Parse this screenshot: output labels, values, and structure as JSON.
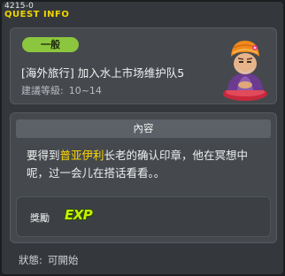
{
  "window": {
    "quest_id": "4215-0",
    "title": "QUEST INFO"
  },
  "quest": {
    "category_badge": "一般",
    "name": "[海外旅行] 加入水上市场维护队5",
    "level_label": "建議等級:",
    "level_range": "10~14",
    "npc_icon": "npc-elder-portrait"
  },
  "content": {
    "header": "內容",
    "description_before": "要得到",
    "description_highlight": "普亚伊利",
    "description_after": "长老的确认印章，他在冥想中呢，过一会儿在搭话看看。。",
    "highlight_color": "#ffd800"
  },
  "reward": {
    "label": "獎勵",
    "exp_text": "EXP"
  },
  "status": {
    "label": "狀態:",
    "value": "可開始"
  },
  "colors": {
    "title": "#f0d400",
    "badge": "#8cc63f",
    "exp": "#c8f000"
  }
}
